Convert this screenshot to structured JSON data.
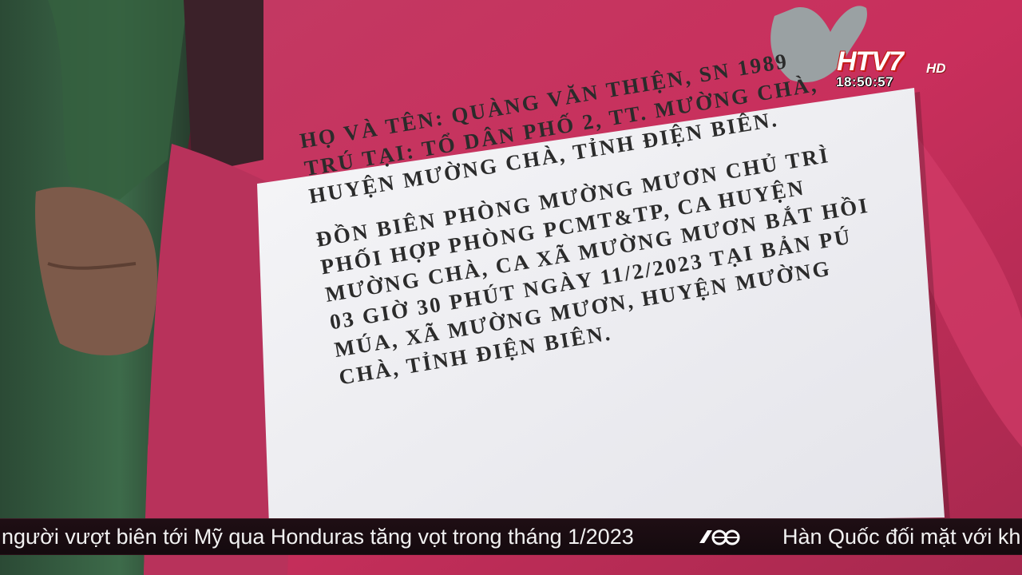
{
  "broadcast": {
    "channel_logo": "HTV7",
    "logo_suffix": "HD",
    "clock": "18:50:57"
  },
  "sign": {
    "lines": [
      "HỌ VÀ TÊN: QUÀNG VĂN THIỆN, SN 1989",
      "TRÚ TẠI: TỔ DÂN PHỐ 2, TT. MƯỜNG CHÀ,",
      "HUYỆN MƯỜNG CHÀ, TỈNH ĐIỆN BIÊN.",
      "ĐỒN BIÊN PHÒNG MƯỜNG MƯƠN CHỦ TRÌ",
      "PHỐI  HỢP  PHÒNG  PCMT&TP,  CA  HUYỆN",
      "MƯỜNG CHÀ, CA XÃ MƯỜNG MƯƠN BẮT HỒI",
      "03 GIỜ 30 PHÚT NGÀY 11/2/2023 TẠI BẢN PÚ",
      "MÚA,  XÃ  MƯỜNG  MƯƠN,  HUYỆN  MƯỜNG",
      "CHÀ, TỈNH ĐIỆN BIÊN."
    ]
  },
  "ticker": {
    "headline_1": "người vượt biên tới Mỹ qua Honduras tăng vọt trong tháng 1/2023",
    "separator_icon": "htv-ticker-logo-icon",
    "headline_2": "Hàn Quốc đối mặt với khủng"
  },
  "colors": {
    "logo_red": "#c61b1b",
    "jacket_pink": "#c4335f",
    "ticker_bg": "#1a0c11"
  }
}
